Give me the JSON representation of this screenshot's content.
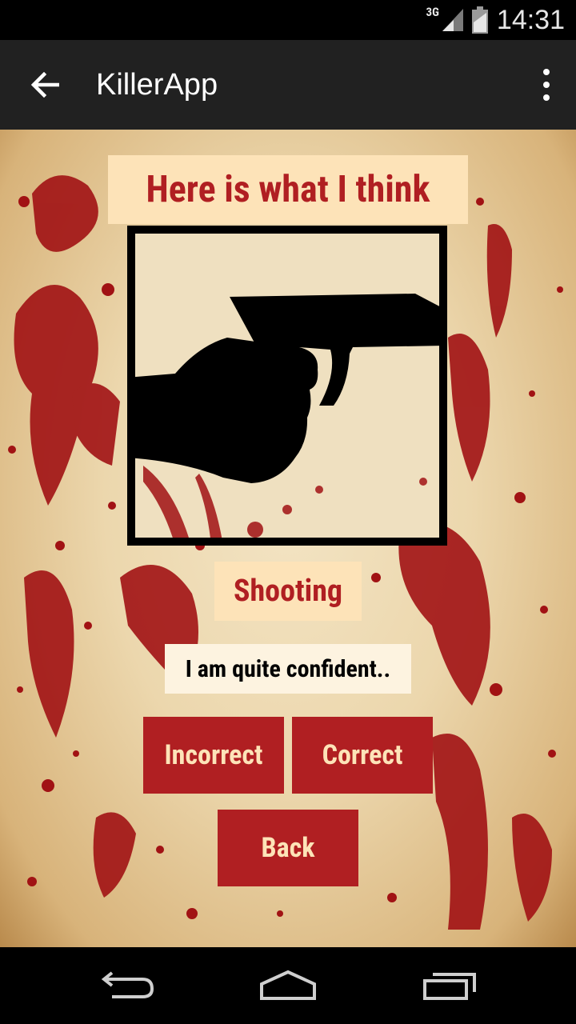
{
  "status_bar": {
    "network": "3G",
    "time": "14:31"
  },
  "app_bar": {
    "title": "KillerApp"
  },
  "main": {
    "heading": "Here is what I think",
    "prediction_label": "Shooting",
    "confidence_text": "I am quite confident..",
    "buttons": {
      "incorrect": "Incorrect",
      "correct": "Correct",
      "back": "Back"
    }
  },
  "colors": {
    "accent": "#b01f22",
    "label_background": "#fde3b8",
    "app_bar": "#212121",
    "blood": "#a11214"
  },
  "icons": {
    "app_bar": [
      "arrow-back-icon",
      "overflow-menu-icon"
    ],
    "status": [
      "signal-icon",
      "battery-icon"
    ],
    "nav": [
      "back-nav-icon",
      "home-nav-icon",
      "recents-nav-icon"
    ],
    "image": "gun-in-hand-icon"
  }
}
